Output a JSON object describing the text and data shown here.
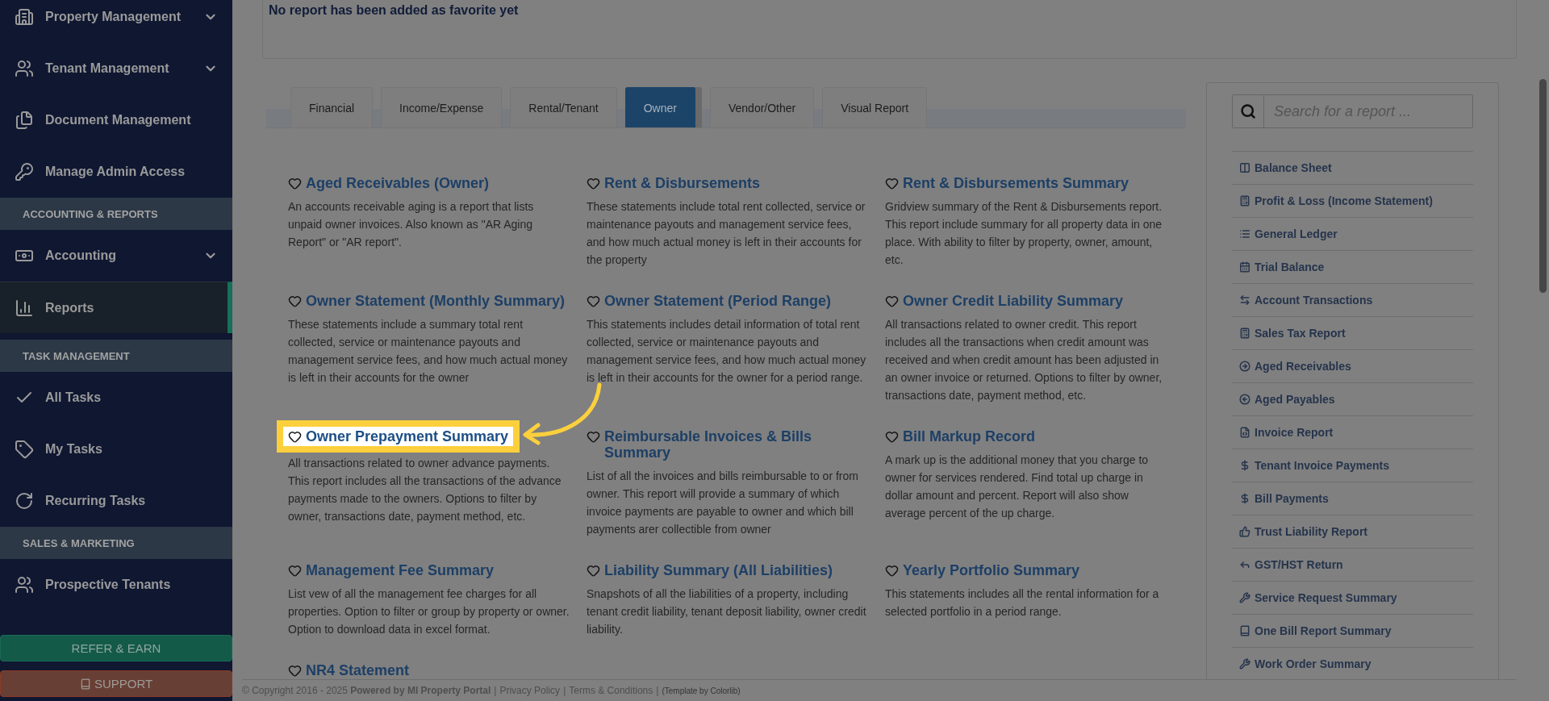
{
  "sidebar": {
    "items": [
      {
        "kind": "group",
        "label": "Property Management",
        "selected": false
      },
      {
        "kind": "group",
        "label": "Tenant Management",
        "selected": false
      },
      {
        "kind": "link",
        "label": "Document Management",
        "selected": false
      },
      {
        "kind": "link",
        "label": "Manage Admin Access",
        "selected": false
      },
      {
        "kind": "section",
        "label": "ACCOUNTING & REPORTS"
      },
      {
        "kind": "group",
        "label": "Accounting",
        "selected": false
      },
      {
        "kind": "link",
        "label": "Reports",
        "selected": true
      },
      {
        "kind": "section",
        "label": "TASK MANAGEMENT"
      },
      {
        "kind": "link",
        "label": "All Tasks",
        "selected": false
      },
      {
        "kind": "link",
        "label": "My Tasks",
        "selected": false
      },
      {
        "kind": "link",
        "label": "Recurring Tasks",
        "selected": false
      },
      {
        "kind": "section",
        "label": "SALES & MARKETING"
      },
      {
        "kind": "link",
        "label": "Prospective Tenants",
        "selected": false
      }
    ],
    "buttons": [
      {
        "kind": "refer",
        "label": "REFER & EARN"
      },
      {
        "kind": "support",
        "label": "SUPPORT"
      }
    ]
  },
  "favorites": {
    "message": "No report has been added as favorite yet"
  },
  "tabs": [
    {
      "label": "Financial",
      "selected": false
    },
    {
      "label": "Income/Expense",
      "selected": false
    },
    {
      "label": "Rental/Tenant",
      "selected": false
    },
    {
      "label": "Owner",
      "selected": true
    },
    {
      "label": "Vendor/Other",
      "selected": false
    },
    {
      "label": "Visual Report",
      "selected": false
    }
  ],
  "reports": [
    {
      "title": "Aged Receivables (Owner)",
      "description": "An accounts receivable aging is a report that lists unpaid owner invoices. Also known as \"AR Aging Report\" or \"AR report\".",
      "highlighted": false
    },
    {
      "title": "Rent & Disbursements",
      "description": "These statements include total rent collected, service or maintenance payouts and management service fees, and how much actual money is left in their accounts for the property",
      "highlighted": false
    },
    {
      "title": "Rent & Disbursements Summary",
      "description": "Gridview summary of the Rent & Disbursements report. This report include summary for all property data in one place. With ability to filter by property, owner, amount, etc.",
      "highlighted": false
    },
    {
      "title": "Owner Statement (Monthly Summary)",
      "description": "These statements include a summary total rent collected, service or maintenance payouts and management service fees, and how much actual money is left in their accounts for the owner",
      "highlighted": false
    },
    {
      "title": "Owner Statement (Period Range)",
      "description": "This statements includes detail information of total rent collected, service or maintenance payouts and management service fees, and how much actual money is left in their accounts for the owner for a period range.",
      "highlighted": false
    },
    {
      "title": "Owner Credit Liability Summary",
      "description": "All transactions related to owner credit. This report includes all the transactions when credit amount was received and when credit amount has been adjusted in an owner invoice or returned. Options to filter by owner, transactions date, payment method, etc.",
      "highlighted": false
    },
    {
      "title": "Owner Prepayment Summary",
      "description": "All transactions related to owner advance payments. This report includes all the transactions of the advance payments made to the owners. Options to filter by owner, transactions date, payment method, etc.",
      "highlighted": true
    },
    {
      "title": "Reimbursable Invoices & Bills Summary",
      "description": "List of all the invoices and bills reimbursable to or from owner. This report will provide a summary of which invoice payments are payable to owner and which bill payments arer collectible from owner",
      "highlighted": false
    },
    {
      "title": "Bill Markup Record",
      "description": "A mark up is the additional money that you charge to owner for services rendered. Find total up charge in dollar amount and percent. Report will also show average percent of the up charge.",
      "highlighted": false
    },
    {
      "title": "Management Fee Summary",
      "description": "List vew of all the management fee charges for all properties. Option to filter or group by property or owner. Option to download data in excel format.",
      "highlighted": false
    },
    {
      "title": "Liability Summary (All Liabilities)",
      "description": "Snapshots of all the liabilities of a property, including tenant credit liability, tenant deposit liability, owner credit liability.",
      "highlighted": false
    },
    {
      "title": "Yearly Portfolio Summary",
      "description": "This statements includes all the rental information for a selected portfolio in a period range.",
      "highlighted": false
    },
    {
      "title": "NR4 Statement",
      "highlighted": false
    }
  ],
  "quick_reports": {
    "search": {
      "placeholder": "Search for a report ..."
    },
    "items": [
      "Balance Sheet",
      "Profit & Loss (Income Statement)",
      "General Ledger",
      "Trial Balance",
      "Account Transactions",
      "Sales Tax Report",
      "Aged Receivables",
      "Aged Payables",
      "Invoice Report",
      "Tenant Invoice Payments",
      "Bill Payments",
      "Trust Liability Report",
      "GST/HST Return",
      "Service Request Summary",
      "One Bill Report Summary",
      "Work Order Summary"
    ]
  },
  "footer": {
    "text": "© Copyright 2016 - 2025 **Powered by MI Property Portal**",
    "separator": "|",
    "links": [
      "Privacy Policy",
      "Terms & Conditions"
    ],
    "credit": "(Template by Colorlib)"
  }
}
